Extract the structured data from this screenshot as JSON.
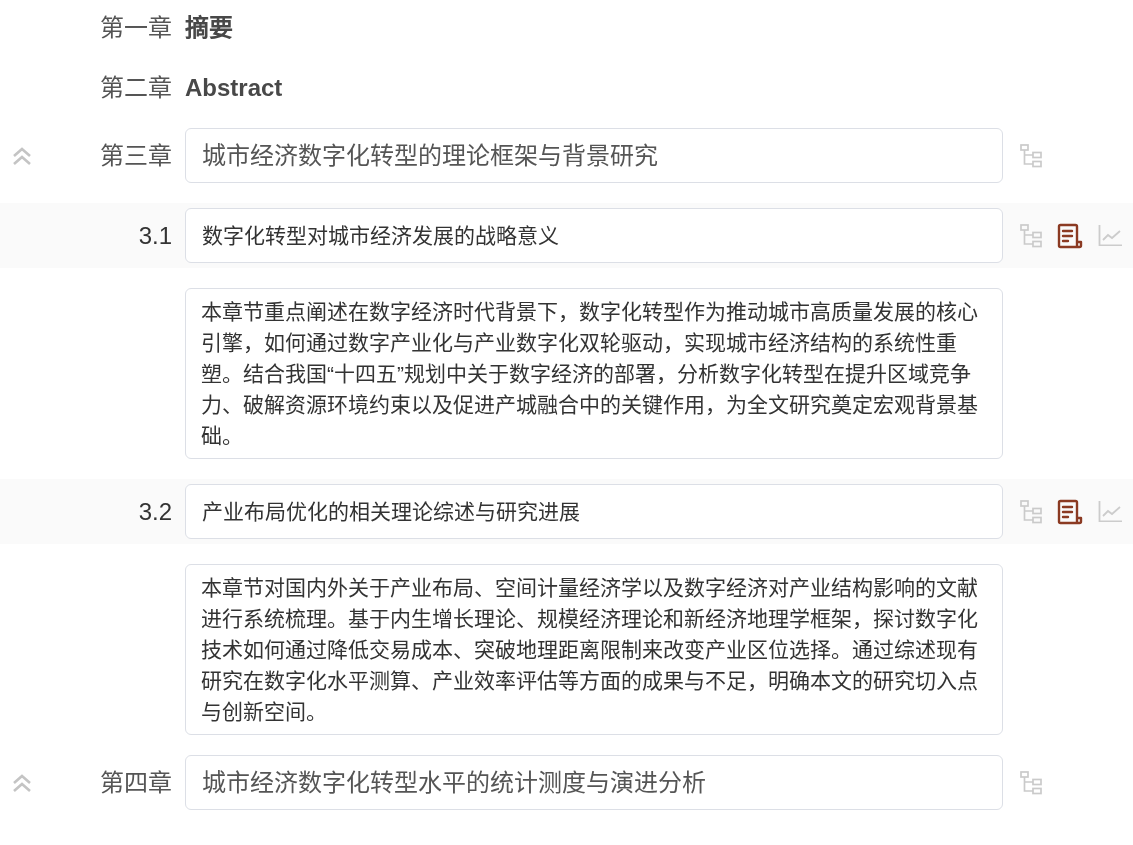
{
  "chapters": [
    {
      "kind": "static",
      "label": "第一章",
      "title": "摘要"
    },
    {
      "kind": "static",
      "label": "第二章",
      "title": "Abstract"
    },
    {
      "kind": "editable",
      "label": "第三章",
      "title": "城市经济数字化转型的理论框架与背景研究",
      "expanded": true,
      "sections": [
        {
          "number": "3.1",
          "title": "数字化转型对城市经济发展的战略意义",
          "summary_open": true,
          "summary": "本章节重点阐述在数字经济时代背景下，数字化转型作为推动城市高质量发展的核心引擎，如何通过数字产业化与产业数字化双轮驱动，实现城市经济结构的系统性重塑。结合我国“十四五”规划中关于数字经济的部署，分析数字化转型在提升区域竞争力、破解资源环境约束以及促进产城融合中的关键作用，为全文研究奠定宏观背景基础。"
        },
        {
          "number": "3.2",
          "title": "产业布局优化的相关理论综述与研究进展",
          "summary_open": true,
          "summary": "本章节对国内外关于产业布局、空间计量经济学以及数字经济对产业结构影响的文献进行系统梳理。基于内生增长理论、规模经济理论和新经济地理学框架，探讨数字化技术如何通过降低交易成本、突破地理距离限制来改变产业区位选择。通过综述现有研究在数字化水平测算、产业效率评估等方面的成果与不足，明确本文的研究切入点与创新空间。"
        }
      ]
    },
    {
      "kind": "editable",
      "label": "第四章",
      "title": "城市经济数字化转型水平的统计测度与演进分析",
      "expanded": true
    }
  ]
}
